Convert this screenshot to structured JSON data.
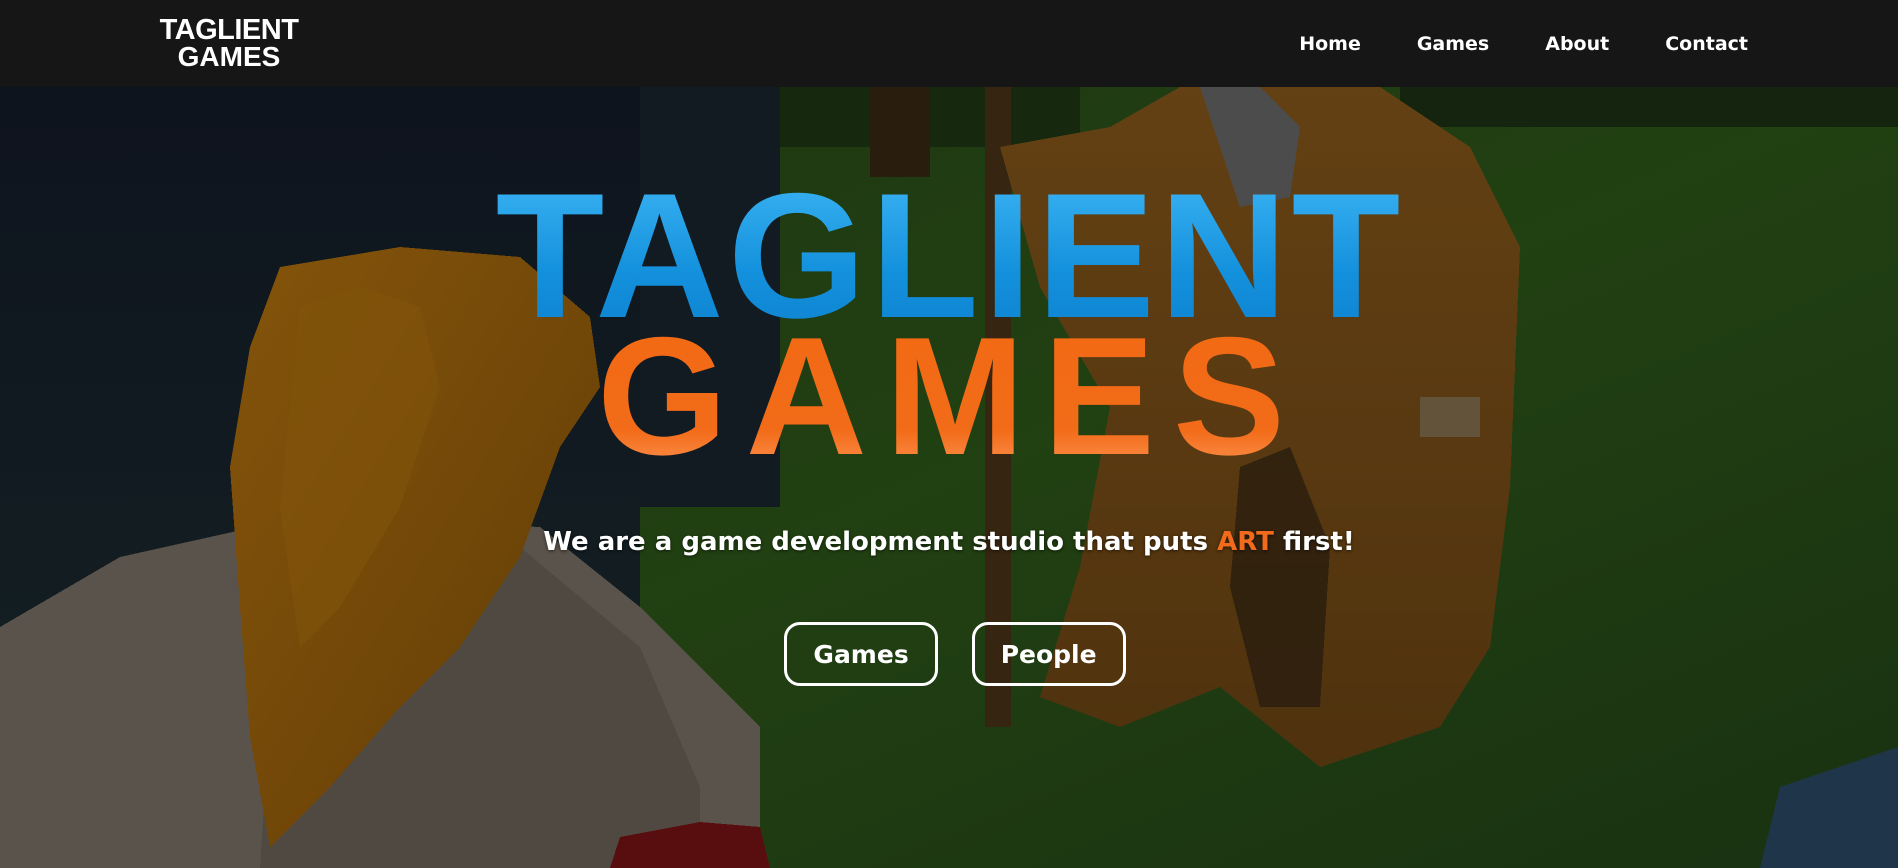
{
  "navbar": {
    "brand_line1": "TAGLIENT",
    "brand_line2": "GAMES",
    "links": [
      {
        "label": "Home"
      },
      {
        "label": "Games"
      },
      {
        "label": "About"
      },
      {
        "label": "Contact"
      }
    ]
  },
  "hero": {
    "logo_line1": "TAGLIENT",
    "logo_line2": "GAMES",
    "tagline_prefix": "We are a game development studio that puts ",
    "tagline_accent": "ART",
    "tagline_suffix": " first!",
    "buttons": [
      {
        "label": "Games"
      },
      {
        "label": "People"
      }
    ]
  },
  "colors": {
    "navbar_bg": "#161616",
    "logo_blue": "#1fa0e8",
    "logo_orange": "#f26b1d",
    "accent": "#f26b1d",
    "text": "#ffffff"
  }
}
